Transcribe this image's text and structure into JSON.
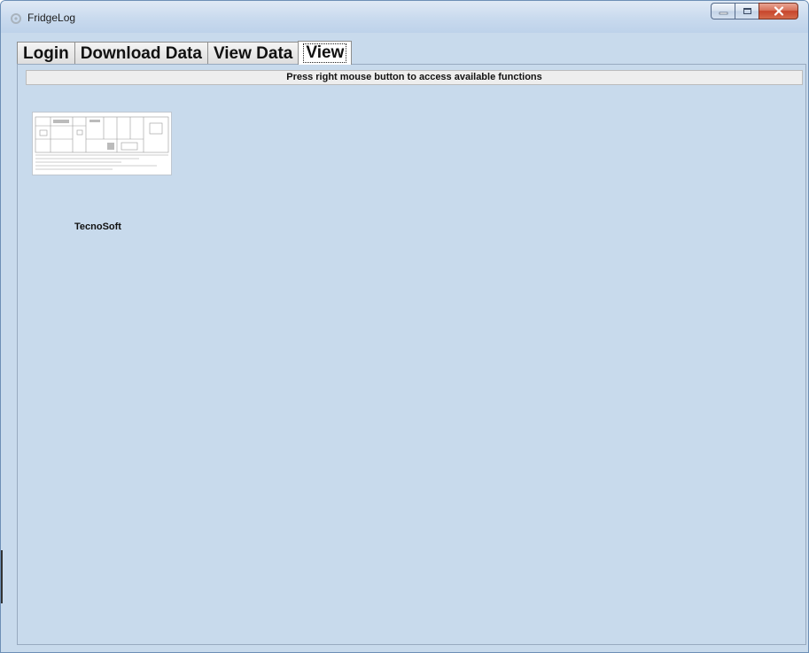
{
  "window": {
    "title": "FridgeLog"
  },
  "caption_buttons": {
    "close_symbol": "x"
  },
  "tabs": [
    {
      "label": "Login",
      "active": false
    },
    {
      "label": "Download Data",
      "active": false
    },
    {
      "label": "View Data",
      "active": false
    },
    {
      "label": "View",
      "active": true
    }
  ],
  "view_panel": {
    "hint": "Press right mouse button to access available functions",
    "map_label": "TecnoSoft"
  },
  "colors": {
    "panel_background": "#c8daec",
    "close_button": "#c7452c"
  }
}
